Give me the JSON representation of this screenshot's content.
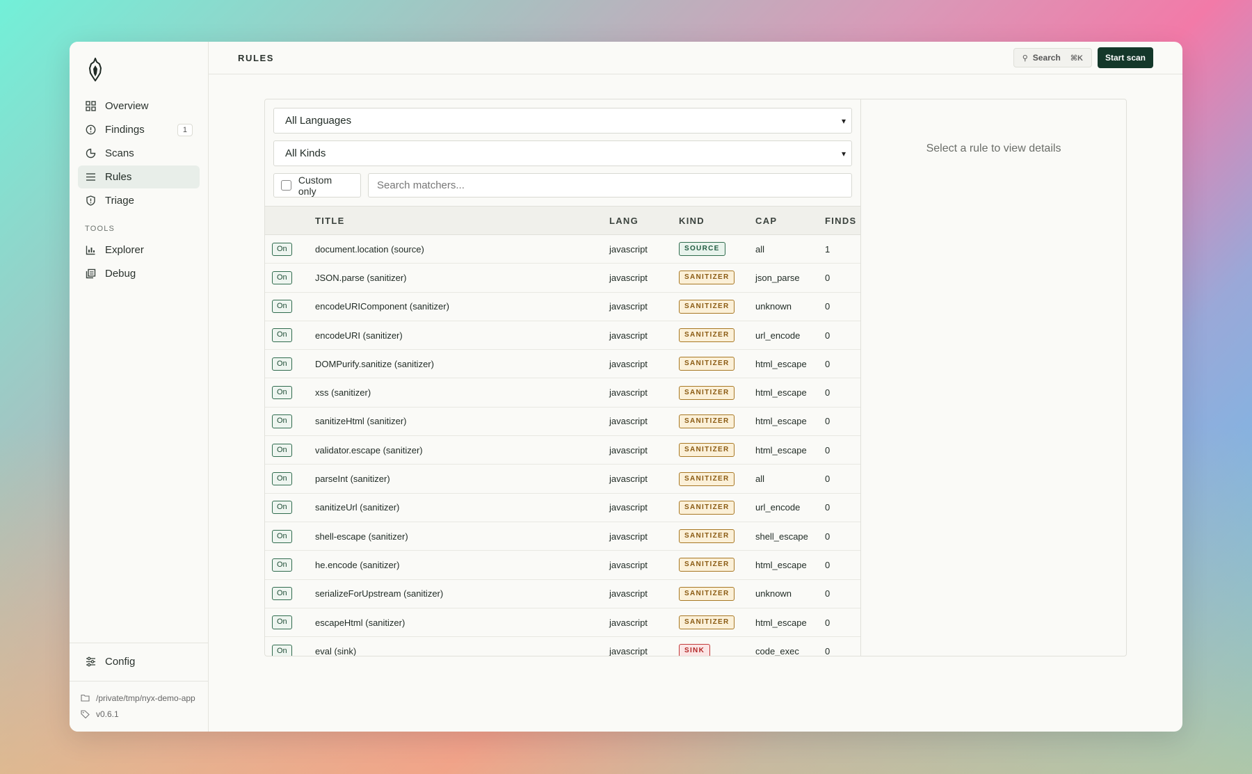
{
  "sidebar": {
    "nav": [
      {
        "label": "Overview",
        "icon": "grid-icon",
        "active": false
      },
      {
        "label": "Findings",
        "icon": "shield-alert-icon",
        "badge": "1",
        "active": false
      },
      {
        "label": "Scans",
        "icon": "pie-icon",
        "active": false
      },
      {
        "label": "Rules",
        "icon": "list-icon",
        "active": true
      },
      {
        "label": "Triage",
        "icon": "shield-icon",
        "active": false
      }
    ],
    "tools_label": "TOOLS",
    "tools": [
      {
        "label": "Explorer",
        "icon": "chart-icon"
      },
      {
        "label": "Debug",
        "icon": "stack-icon"
      }
    ],
    "config_label": "Config",
    "path": "/private/tmp/nyx-demo-app",
    "version": "v0.6.1"
  },
  "topbar": {
    "title": "RULES",
    "search_label": "Search",
    "search_shortcut": "⌘K",
    "start_label": "Start scan"
  },
  "filters": {
    "language": "All Languages",
    "kind": "All Kinds",
    "custom_only_label": "Custom only",
    "search_placeholder": "Search matchers..."
  },
  "table": {
    "headers": {
      "title": "TITLE",
      "lang": "LANG",
      "kind": "KIND",
      "cap": "CAP",
      "finds": "FINDS"
    },
    "toggle_label": "On",
    "rows": [
      {
        "title": "document.location (source)",
        "lang": "javascript",
        "kind": "SOURCE",
        "cap": "all",
        "finds": "1"
      },
      {
        "title": "JSON.parse (sanitizer)",
        "lang": "javascript",
        "kind": "SANITIZER",
        "cap": "json_parse",
        "finds": "0"
      },
      {
        "title": "encodeURIComponent (sanitizer)",
        "lang": "javascript",
        "kind": "SANITIZER",
        "cap": "unknown",
        "finds": "0"
      },
      {
        "title": "encodeURI (sanitizer)",
        "lang": "javascript",
        "kind": "SANITIZER",
        "cap": "url_encode",
        "finds": "0"
      },
      {
        "title": "DOMPurify.sanitize (sanitizer)",
        "lang": "javascript",
        "kind": "SANITIZER",
        "cap": "html_escape",
        "finds": "0"
      },
      {
        "title": "xss (sanitizer)",
        "lang": "javascript",
        "kind": "SANITIZER",
        "cap": "html_escape",
        "finds": "0"
      },
      {
        "title": "sanitizeHtml (sanitizer)",
        "lang": "javascript",
        "kind": "SANITIZER",
        "cap": "html_escape",
        "finds": "0"
      },
      {
        "title": "validator.escape (sanitizer)",
        "lang": "javascript",
        "kind": "SANITIZER",
        "cap": "html_escape",
        "finds": "0"
      },
      {
        "title": "parseInt (sanitizer)",
        "lang": "javascript",
        "kind": "SANITIZER",
        "cap": "all",
        "finds": "0"
      },
      {
        "title": "sanitizeUrl (sanitizer)",
        "lang": "javascript",
        "kind": "SANITIZER",
        "cap": "url_encode",
        "finds": "0"
      },
      {
        "title": "shell-escape (sanitizer)",
        "lang": "javascript",
        "kind": "SANITIZER",
        "cap": "shell_escape",
        "finds": "0"
      },
      {
        "title": "he.encode (sanitizer)",
        "lang": "javascript",
        "kind": "SANITIZER",
        "cap": "html_escape",
        "finds": "0"
      },
      {
        "title": "serializeForUpstream (sanitizer)",
        "lang": "javascript",
        "kind": "SANITIZER",
        "cap": "unknown",
        "finds": "0"
      },
      {
        "title": "escapeHtml (sanitizer)",
        "lang": "javascript",
        "kind": "SANITIZER",
        "cap": "html_escape",
        "finds": "0"
      },
      {
        "title": "eval (sink)",
        "lang": "javascript",
        "kind": "SINK",
        "cap": "code_exec",
        "finds": "0"
      }
    ]
  },
  "kind_colors": {
    "SOURCE": {
      "fg": "#1f5a3f",
      "bg": "#e8f3ec",
      "border": "#2f6b4d"
    },
    "SANITIZER": {
      "fg": "#8a5a12",
      "bg": "#fbf0d8",
      "border": "#a87824"
    },
    "SINK": {
      "fg": "#b32626",
      "bg": "#fbe5e5",
      "border": "#c33a3a"
    }
  },
  "detail": {
    "empty_message": "Select a rule to view details"
  }
}
